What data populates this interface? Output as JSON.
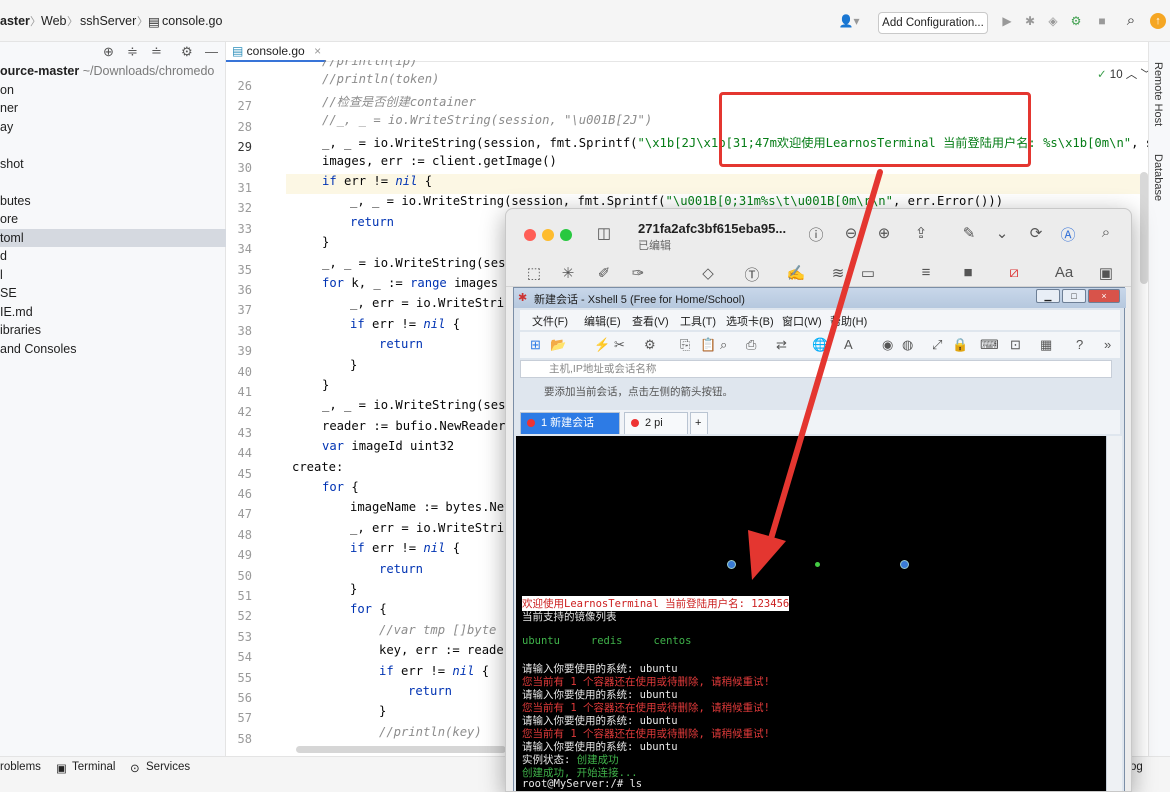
{
  "topbar": {
    "crumbs": [
      "aster",
      "Web",
      "sshServer",
      "console.go"
    ],
    "add_config": "Add Configuration..."
  },
  "project": {
    "root_name": "ource-master",
    "root_path": "~/Downloads/chromedo",
    "items": [
      "on",
      "ner",
      "ay",
      "",
      "shot",
      "",
      "butes",
      "ore",
      "toml",
      "d",
      "l",
      "SE",
      "IE.md",
      "ibraries",
      "and Consoles"
    ],
    "selected_index": 8
  },
  "editor": {
    "tab": "console.go",
    "fold_info": "10",
    "current_line": "29",
    "line_numbers": [
      "26",
      "27",
      "28",
      "29",
      "30",
      "31",
      "32",
      "33",
      "34",
      "35",
      "36",
      "37",
      "38",
      "39",
      "40",
      "41",
      "42",
      "43",
      "44",
      "45",
      "46",
      "47",
      "48",
      "49",
      "50",
      "51",
      "52",
      "53",
      "54",
      "55",
      "56",
      "57",
      "58"
    ],
    "partial_top_line": "//println(ip)",
    "code": {
      "l26": "//println(token)",
      "l27": "//检查是否创建container",
      "l28": "//_, _ = io.WriteString(session, \"\\u001B[2J\")",
      "l29a": "_, _ = io.WriteString(session, fmt.Sprintf(",
      "l29b": "\"\\x1b[2J\\x1b[31;47m欢迎使用LearnosTerminal 当前登陆用户名: %s\\x1b[0m\\n\"",
      "l29c": ", ses",
      "l30": "images, err := client.getImage()",
      "l31a": "if",
      "l31b": " err != ",
      "l31c": "nil",
      "l31d": " {",
      "l32a": "_, _ = io.WriteString(session, fmt.Sprintf(",
      "l32b": "\"\\u001B[0;31m%s\\t\\u001B[0m\\r\\n\"",
      "l32c": ", err.Error()))",
      "l33": "return",
      "l34": "}",
      "l35": "_, _ = io.WriteString(ses",
      "l36a": "for",
      "l36b": " k, _ := ",
      "l36c": "range",
      "l36d": " images",
      "l37": "_, err = io.WriteStri",
      "l38a": "if",
      "l38b": " err != ",
      "l38c": "nil",
      "l38d": " {",
      "l39": "return",
      "l40": "}",
      "l41": "}",
      "l42": "_, _ = io.WriteString(ses",
      "l43": "reader := bufio.NewReader",
      "l44a": "var",
      "l44b": " imageId uint32",
      "l45": "create:",
      "l46a": "for",
      "l46b": " {",
      "l47": "imageName := bytes.Nev",
      "l48": "_, err = io.WriteStri",
      "l49a": "if",
      "l49b": " err != ",
      "l49c": "nil",
      "l49d": " {",
      "l50": "return",
      "l51": "}",
      "l52a": "for",
      "l52b": " {",
      "l53": "//var tmp []byte",
      "l54": "key, err := reade",
      "l55a": "if",
      "l55b": " err != ",
      "l55c": "nil",
      "l55d": " {",
      "l56": "return",
      "l57": "}",
      "l58": "//println(key)"
    }
  },
  "right_strip": {
    "labels": [
      "Remote Host",
      "Database"
    ]
  },
  "bottombar": {
    "items": [
      "roblems",
      "Terminal",
      "Services",
      "og"
    ]
  },
  "preview": {
    "title": "271fa2afc3bf615eba95...",
    "subtitle": "已编辑"
  },
  "xshell": {
    "title": "新建会话 - Xshell 5 (Free for Home/School)",
    "menu": [
      "文件(F)",
      "编辑(E)",
      "查看(V)",
      "工具(T)",
      "选项卡(B)",
      "窗口(W)",
      "帮助(H)"
    ],
    "address_placeholder": "主机,IP地址或会话名称",
    "hint": "要添加当前会话，点击左侧的箭头按钮。",
    "tabs": [
      "1 新建会话",
      "2 pi"
    ],
    "terminal_lines": [
      {
        "text": "欢迎使用LearnosTerminal 当前登陆用户名: 123456",
        "style": "hl"
      },
      {
        "text": "当前支持的镜像列表",
        "style": "normal"
      },
      {
        "text": "",
        "style": "normal"
      },
      {
        "text": "ubuntu   redis   centos",
        "style": "grn"
      },
      {
        "text": "",
        "style": "normal"
      },
      {
        "text": "请输入你要使用的系统: ubuntu",
        "style": "normal"
      },
      {
        "text": "您当前有 1 个容器还在使用或待删除, 请稍候重试!",
        "style": "red"
      },
      {
        "text": "请输入你要使用的系统: ubuntu",
        "style": "normal"
      },
      {
        "text": "您当前有 1 个容器还在使用或待删除, 请稍候重试!",
        "style": "red"
      },
      {
        "text": "请输入你要使用的系统: ubuntu",
        "style": "normal"
      },
      {
        "text": "您当前有 1 个容器还在使用或待删除, 请稍候重试!",
        "style": "red"
      },
      {
        "text": "请输入你要使用的系统: ubuntu",
        "style": "normal"
      },
      {
        "text": "实例状态: 创建成功",
        "style": "mixed"
      },
      {
        "text": "创建成功, 开始连接...",
        "style": "grn"
      },
      {
        "text": "root@MyServer:/# ls",
        "style": "normal"
      }
    ],
    "status_label": "实例状态:",
    "status_value": "创建成功"
  },
  "colors": {
    "annotation_red": "#e43630",
    "keyword_blue": "#0033b3",
    "string_green": "#067d17",
    "terminal_bg": "#000000"
  }
}
